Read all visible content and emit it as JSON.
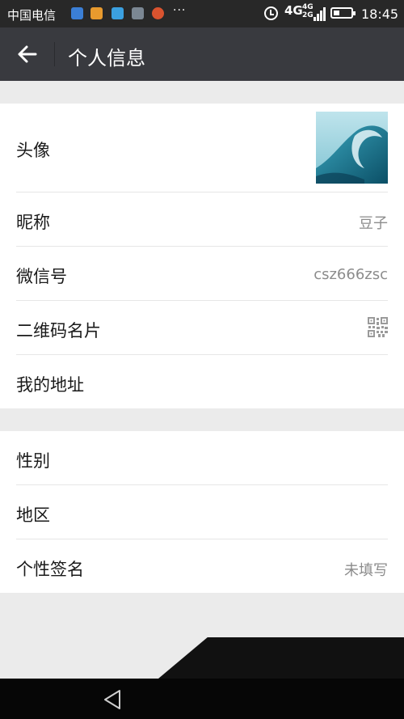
{
  "status_bar": {
    "carrier": "中国电信",
    "more": "···",
    "network_primary": "4G",
    "network_secondary_top": "4G",
    "network_secondary_bottom": "2G",
    "time": "18:45",
    "battery_level": 0.3,
    "icons": [
      "message-app-icon",
      "photo-app-icon",
      "map-app-icon",
      "gallery-app-icon",
      "weibo-app-icon",
      "alarm-icon",
      "signal-icon",
      "battery-icon"
    ]
  },
  "header": {
    "title": "个人信息",
    "back_icon": "arrow-left-icon"
  },
  "section1": {
    "rows": [
      {
        "label": "头像",
        "value": ""
      },
      {
        "label": "昵称",
        "value": "豆子"
      },
      {
        "label": "微信号",
        "value": "csz666zsc"
      },
      {
        "label": "二维码名片",
        "value": ""
      },
      {
        "label": "我的地址",
        "value": ""
      }
    ]
  },
  "section2": {
    "rows": [
      {
        "label": "性别",
        "value": ""
      },
      {
        "label": "地区",
        "value": ""
      },
      {
        "label": "个性签名",
        "value": "未填写"
      }
    ]
  },
  "colors": {
    "titlebar": "#393a3f",
    "statusbar": "#282828",
    "background": "#ebebeb",
    "row_bg": "#ffffff",
    "value_text": "#8c8c8c"
  },
  "navigation_bar": {
    "back_icon": "triangle-back-icon"
  }
}
